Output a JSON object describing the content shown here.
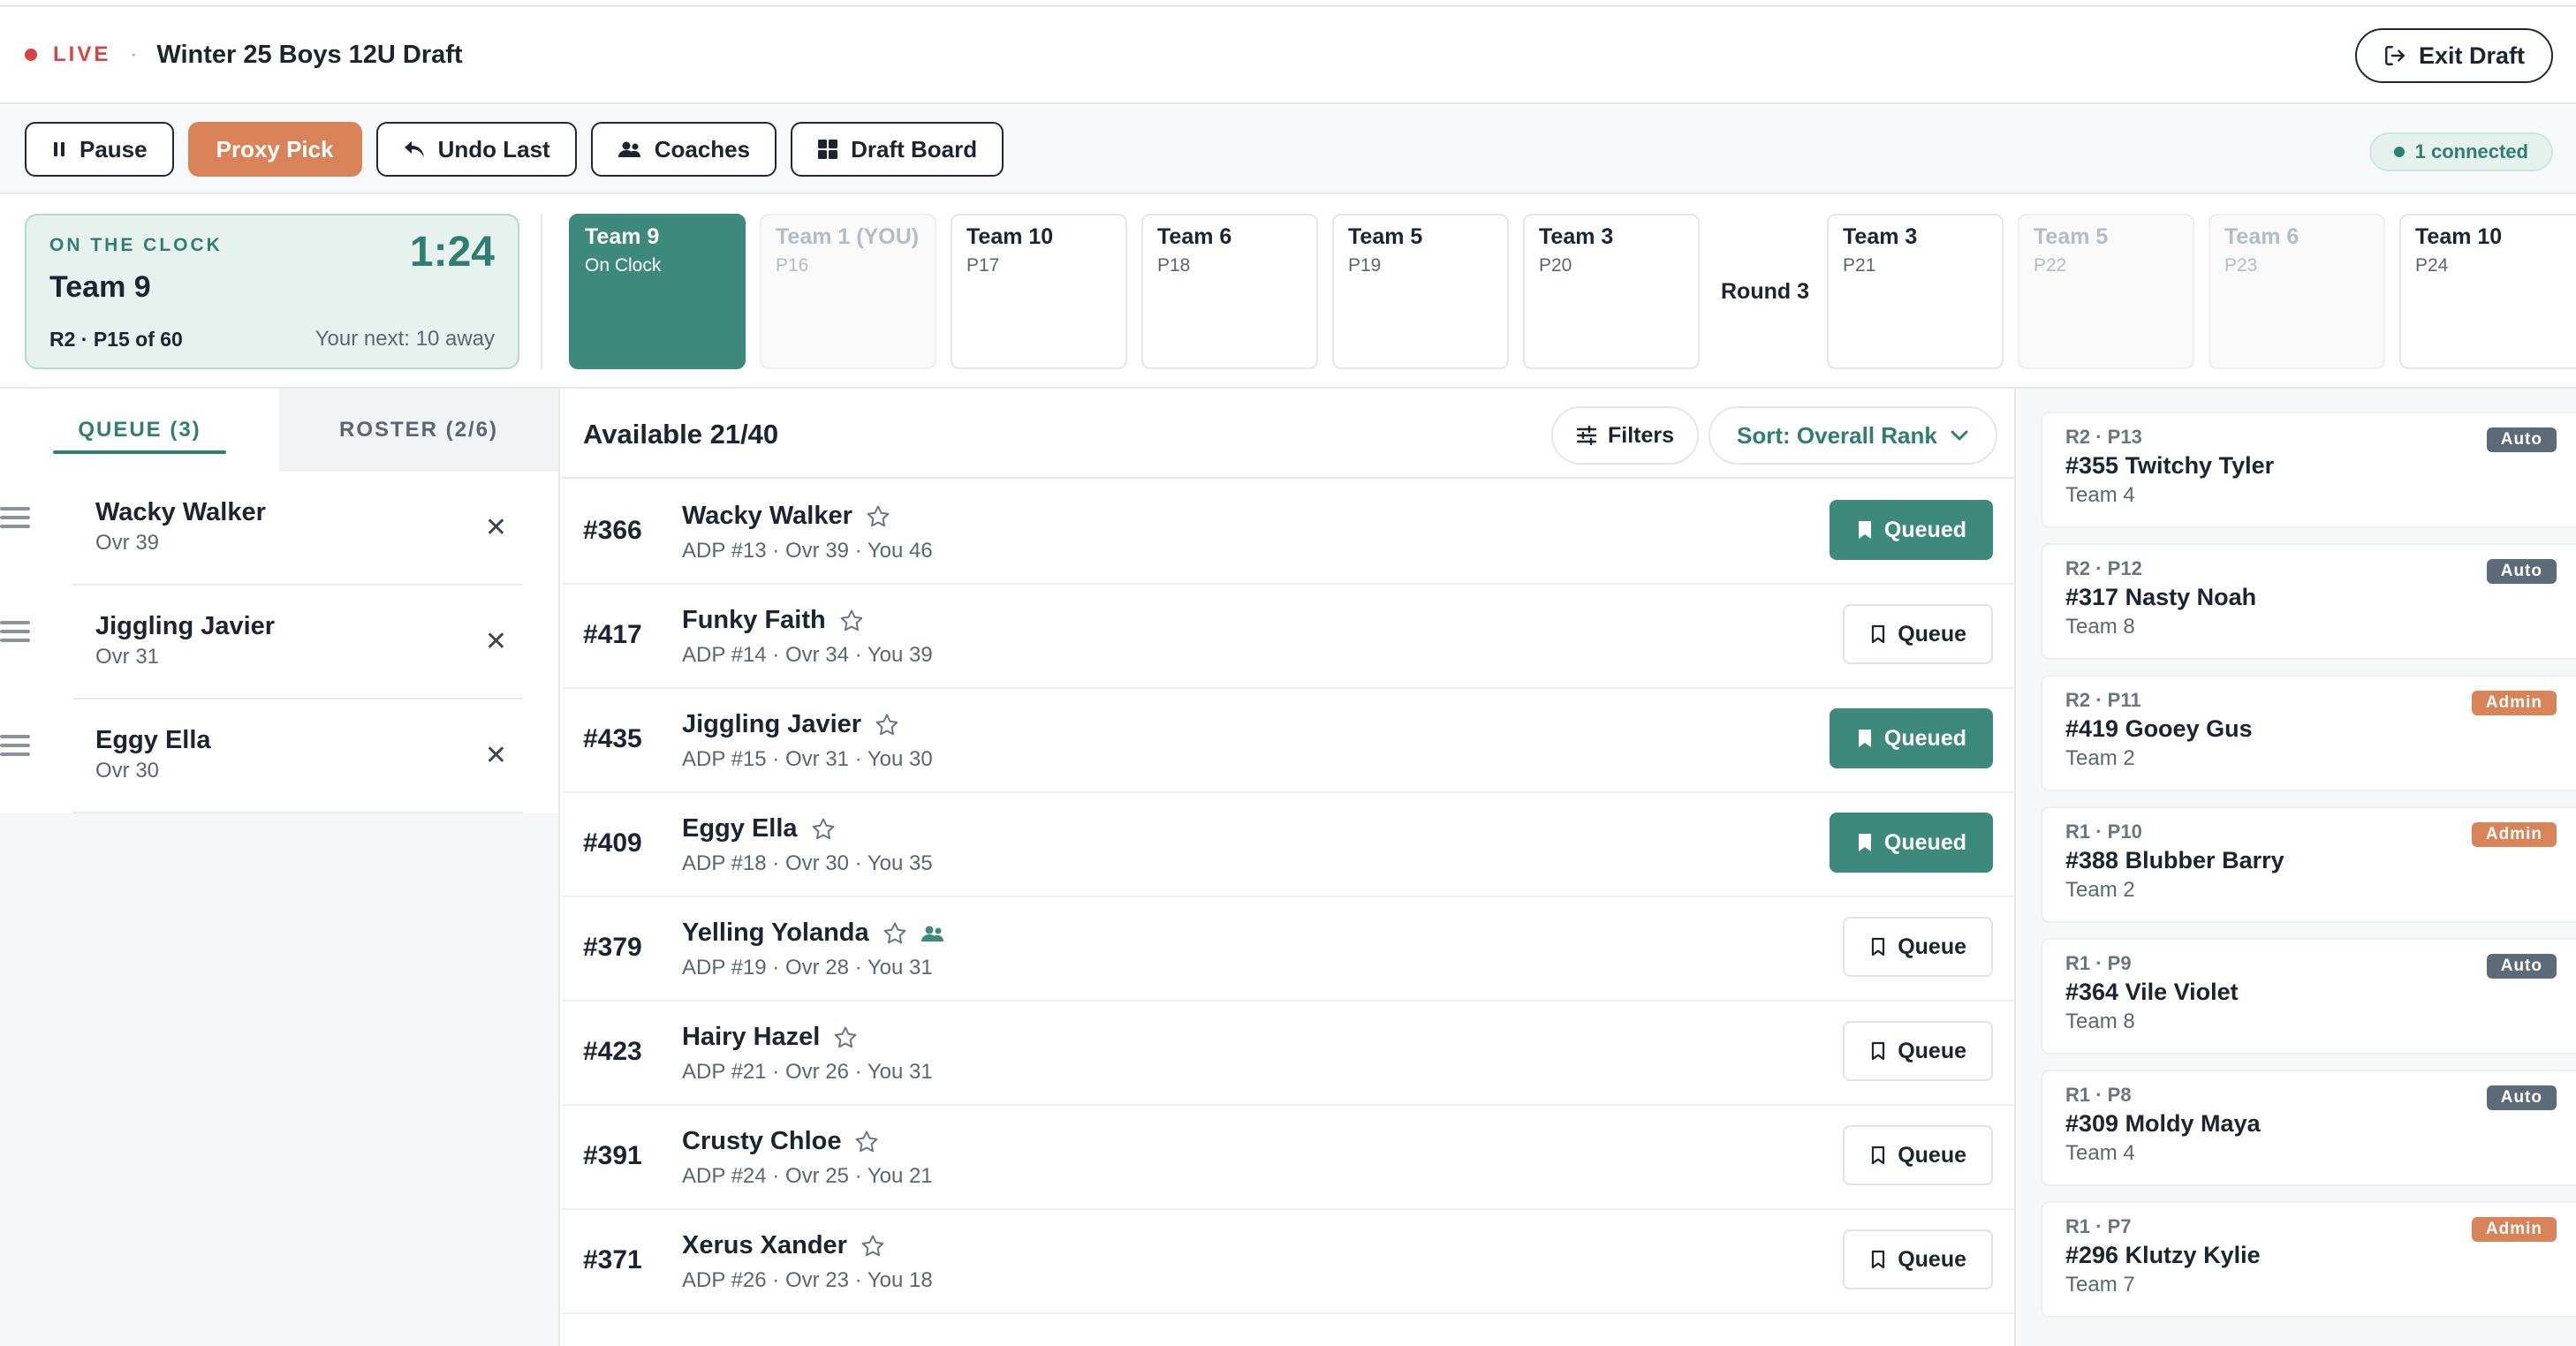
{
  "header": {
    "live_label": "LIVE",
    "separator": "·",
    "title": "Winter 25 Boys 12U Draft",
    "exit_label": "Exit Draft"
  },
  "toolbar": {
    "pause_label": "Pause",
    "proxy_label": "Proxy Pick",
    "undo_label": "Undo Last",
    "coaches_label": "Coaches",
    "board_label": "Draft Board",
    "connected_label": "1 connected"
  },
  "on_clock": {
    "label": "ON THE CLOCK",
    "timer": "1:24",
    "team": "Team 9",
    "pick_info": "R2 · P15 of 60",
    "next_info": "Your next: 10 away"
  },
  "pick_strip": {
    "round_label": "Round 3",
    "picks": [
      {
        "team": "Team 9",
        "sub": "On Clock",
        "state": "current"
      },
      {
        "team": "Team 1 (YOU)",
        "sub": "P16",
        "state": "faded"
      },
      {
        "team": "Team 10",
        "sub": "P17",
        "state": "normal"
      },
      {
        "team": "Team 6",
        "sub": "P18",
        "state": "normal"
      },
      {
        "team": "Team 5",
        "sub": "P19",
        "state": "normal"
      },
      {
        "team": "Team 3",
        "sub": "P20",
        "state": "normal"
      },
      {
        "team": "Team 3",
        "sub": "P21",
        "state": "normal"
      },
      {
        "team": "Team 5",
        "sub": "P22",
        "state": "faded"
      },
      {
        "team": "Team 6",
        "sub": "P23",
        "state": "faded"
      },
      {
        "team": "Team 10",
        "sub": "P24",
        "state": "normal"
      }
    ]
  },
  "left_panel": {
    "tabs": [
      "QUEUE (3)",
      "ROSTER (2/6)"
    ],
    "queue": [
      {
        "name": "Wacky Walker",
        "ovr": "Ovr 39"
      },
      {
        "name": "Jiggling Javier",
        "ovr": "Ovr 31"
      },
      {
        "name": "Eggy Ella",
        "ovr": "Ovr 30"
      }
    ]
  },
  "center": {
    "available_label": "Available 21/40",
    "filters_label": "Filters",
    "sort_label": "Sort: Overall Rank",
    "players": [
      {
        "rank": "#366",
        "name": "Wacky Walker",
        "stats": "ADP #13 · Ovr 39 · You 46",
        "button": "Queued",
        "queued": true,
        "group": false
      },
      {
        "rank": "#417",
        "name": "Funky Faith",
        "stats": "ADP #14 · Ovr 34 · You 39",
        "button": "Queue",
        "queued": false,
        "group": false
      },
      {
        "rank": "#435",
        "name": "Jiggling Javier",
        "stats": "ADP #15 · Ovr 31 · You 30",
        "button": "Queued",
        "queued": true,
        "group": false
      },
      {
        "rank": "#409",
        "name": "Eggy Ella",
        "stats": "ADP #18 · Ovr 30 · You 35",
        "button": "Queued",
        "queued": true,
        "group": false
      },
      {
        "rank": "#379",
        "name": "Yelling Yolanda",
        "stats": "ADP #19 · Ovr 28 · You 31",
        "button": "Queue",
        "queued": false,
        "group": true
      },
      {
        "rank": "#423",
        "name": "Hairy Hazel",
        "stats": "ADP #21 · Ovr 26 · You 31",
        "button": "Queue",
        "queued": false,
        "group": false
      },
      {
        "rank": "#391",
        "name": "Crusty Chloe",
        "stats": "ADP #24 · Ovr 25 · You 21",
        "button": "Queue",
        "queued": false,
        "group": false
      },
      {
        "rank": "#371",
        "name": "Xerus Xander",
        "stats": "ADP #26 · Ovr 23 · You 18",
        "button": "Queue",
        "queued": false,
        "group": false
      }
    ]
  },
  "feed": [
    {
      "pick": "R2 · P13",
      "player": "#355 Twitchy Tyler",
      "team": "Team 4",
      "badge": "Auto",
      "badge_type": "auto"
    },
    {
      "pick": "R2 · P12",
      "player": "#317 Nasty Noah",
      "team": "Team 8",
      "badge": "Auto",
      "badge_type": "auto"
    },
    {
      "pick": "R2 · P11",
      "player": "#419 Gooey Gus",
      "team": "Team 2",
      "badge": "Admin",
      "badge_type": "admin"
    },
    {
      "pick": "R1 · P10",
      "player": "#388 Blubber Barry",
      "team": "Team 2",
      "badge": "Admin",
      "badge_type": "admin"
    },
    {
      "pick": "R1 · P9",
      "player": "#364 Vile Violet",
      "team": "Team 8",
      "badge": "Auto",
      "badge_type": "auto"
    },
    {
      "pick": "R1 · P8",
      "player": "#309 Moldy Maya",
      "team": "Team 4",
      "badge": "Auto",
      "badge_type": "auto"
    },
    {
      "pick": "R1 · P7",
      "player": "#296 Klutzy Kylie",
      "team": "Team 7",
      "badge": "Admin",
      "badge_type": "admin"
    }
  ],
  "colors": {
    "accent_teal": "#3d8a7d",
    "accent_orange": "#d98458",
    "live_red": "#d64545"
  }
}
